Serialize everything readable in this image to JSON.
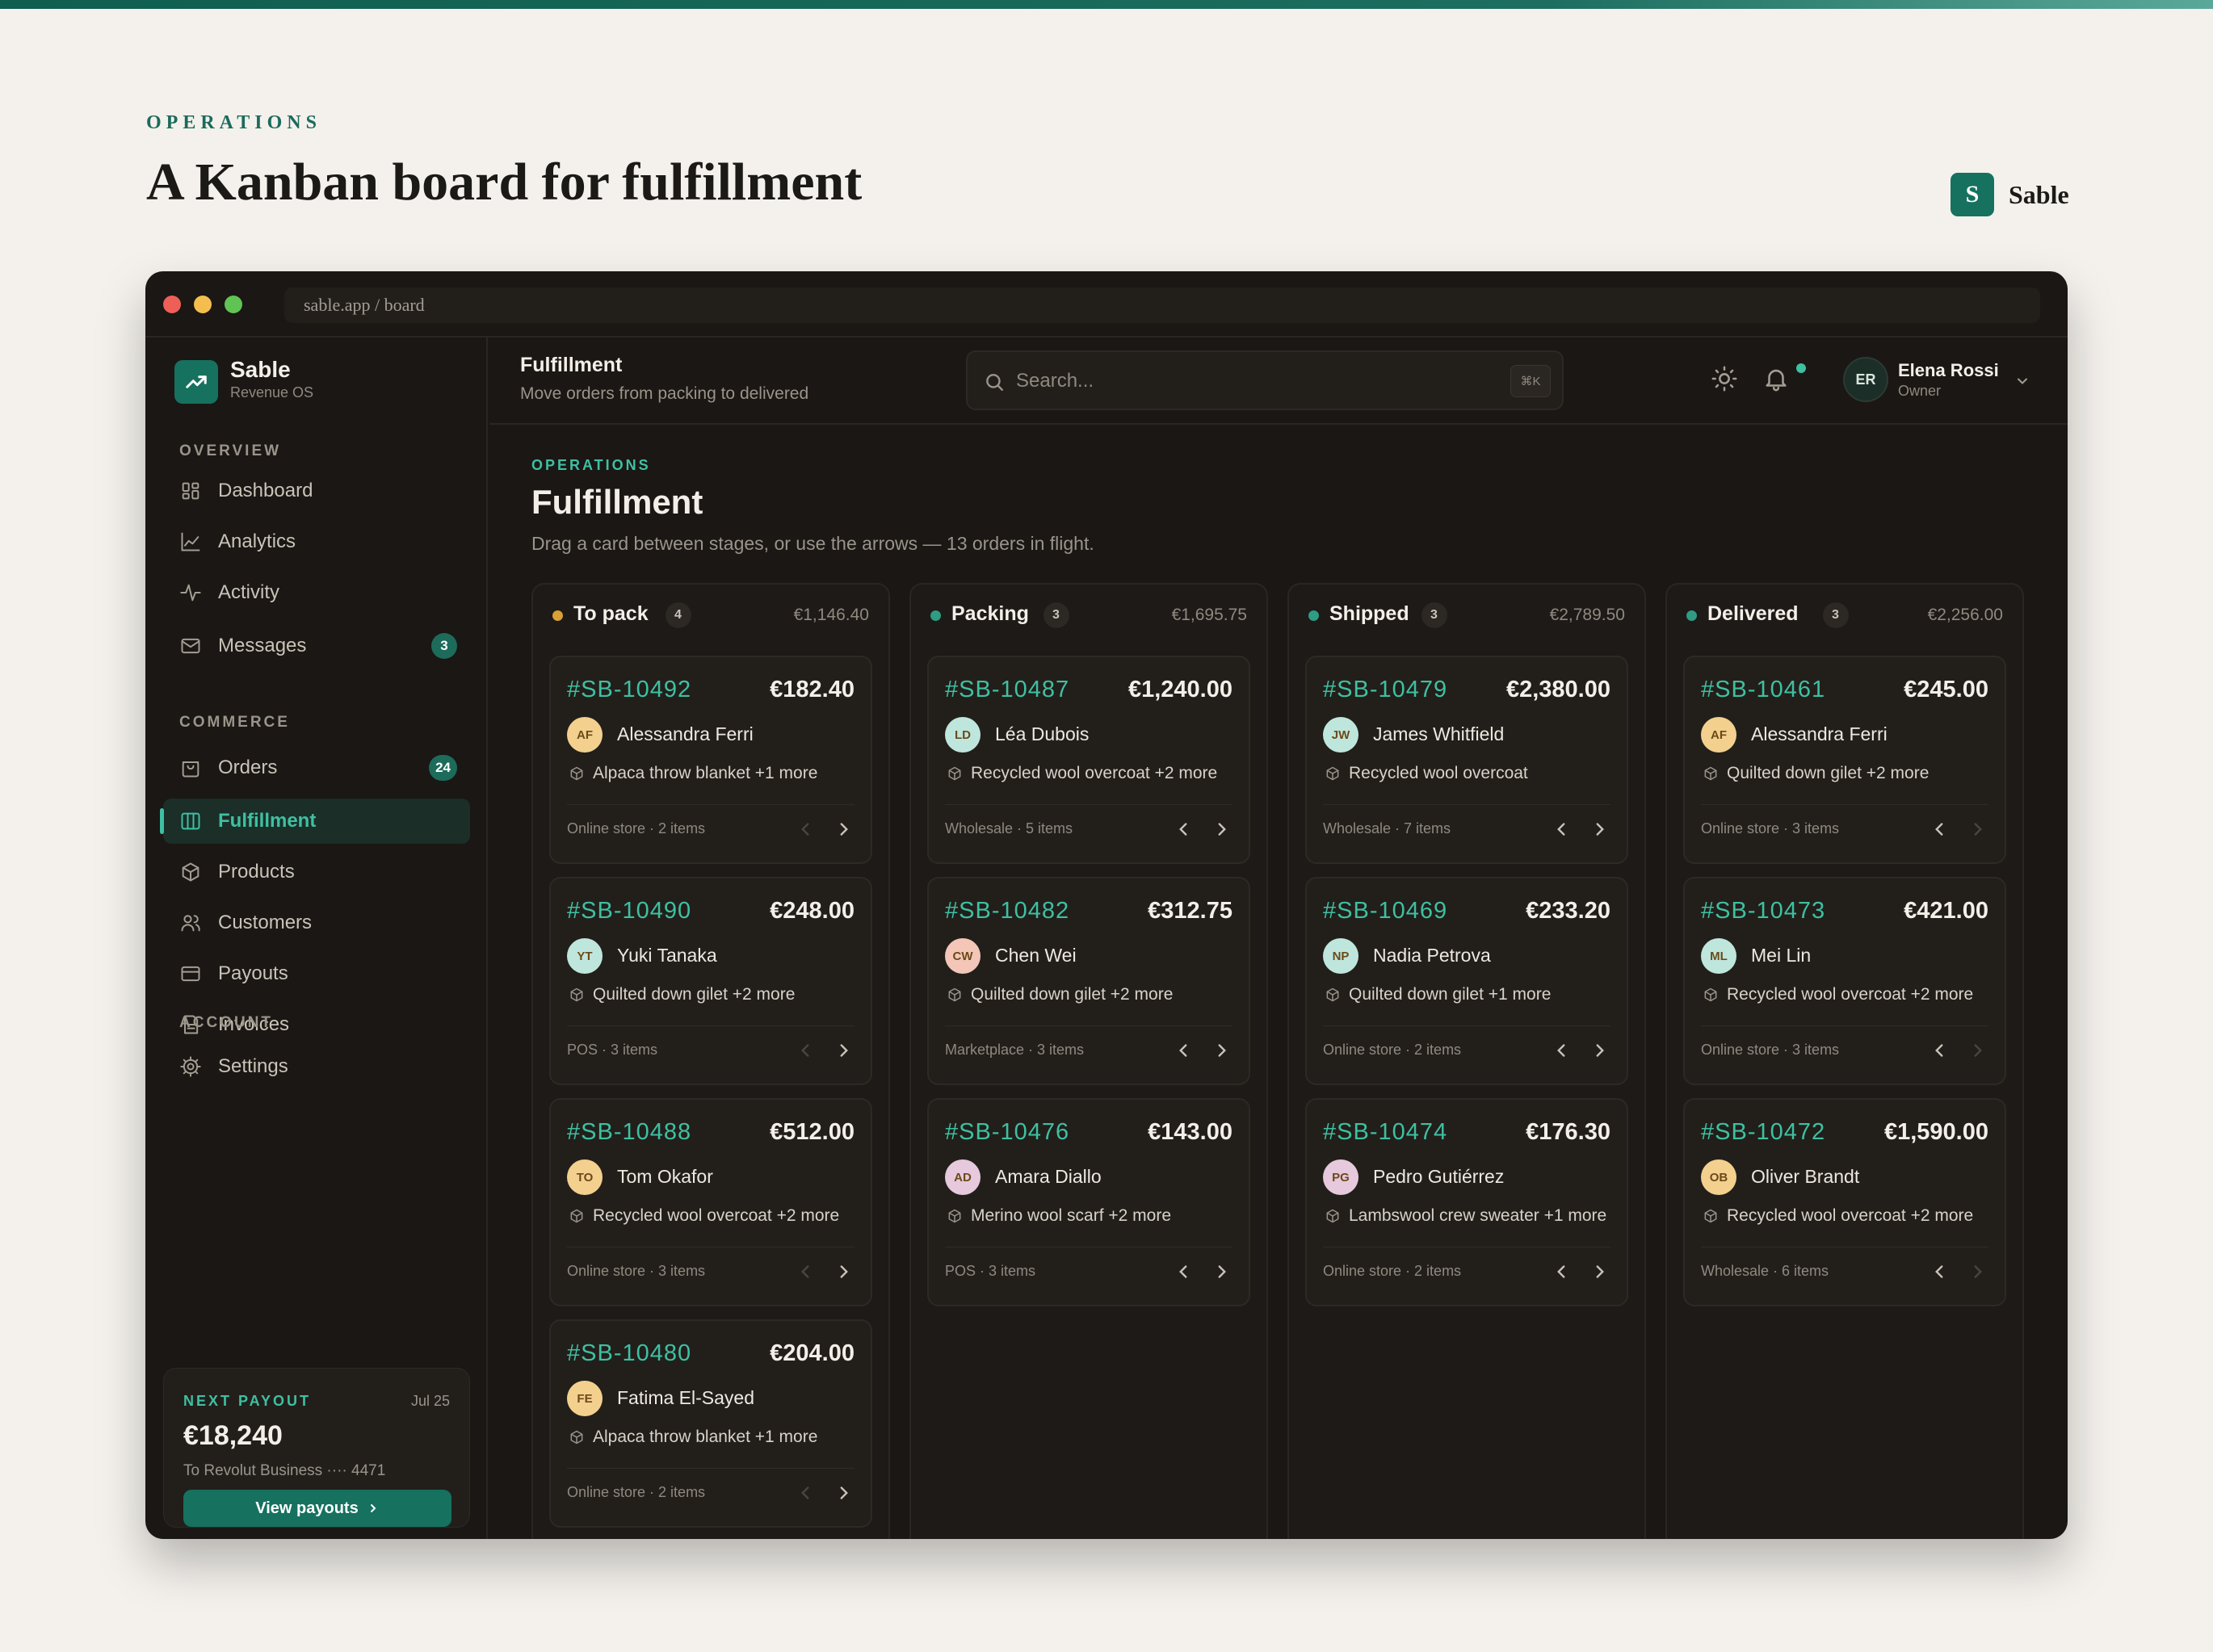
{
  "page": {
    "eyebrow": "OPERATIONS",
    "title": "A Kanban board for fulfillment",
    "brand_letter": "S",
    "brand_name": "Sable"
  },
  "browser": {
    "url": "sable.app / board"
  },
  "sidebar": {
    "app_name": "Sable",
    "app_sub": "Revenue OS",
    "sections": [
      {
        "label": "OVERVIEW",
        "items": [
          {
            "label": "Dashboard",
            "icon": "grid-icon"
          },
          {
            "label": "Analytics",
            "icon": "chart-line-icon"
          },
          {
            "label": "Activity",
            "icon": "pulse-icon"
          },
          {
            "label": "Messages",
            "icon": "mail-icon",
            "badge": "3"
          }
        ]
      },
      {
        "label": "COMMERCE",
        "items": [
          {
            "label": "Orders",
            "icon": "bag-icon",
            "badge": "24"
          },
          {
            "label": "Fulfillment",
            "icon": "board-icon",
            "active": true
          },
          {
            "label": "Products",
            "icon": "box-icon"
          },
          {
            "label": "Customers",
            "icon": "users-icon"
          },
          {
            "label": "Payouts",
            "icon": "card-icon"
          },
          {
            "label": "Invoices",
            "icon": "file-icon"
          }
        ]
      },
      {
        "label": "ACCOUNT",
        "items": [
          {
            "label": "Settings",
            "icon": "gear-icon"
          }
        ]
      }
    ],
    "payout": {
      "label": "NEXT PAYOUT",
      "date": "Jul 25",
      "amount": "€18,240",
      "destination": "To Revolut Business ···· 4471",
      "button": "View payouts"
    }
  },
  "header": {
    "title": "Fulfillment",
    "subtitle": "Move orders from packing to delivered",
    "search_placeholder": "Search...",
    "shortcut": "⌘K",
    "user_initials": "ER",
    "user_name": "Elena Rossi",
    "user_role": "Owner"
  },
  "content": {
    "eyebrow": "OPERATIONS",
    "title": "Fulfillment",
    "description": "Drag a card between stages, or use the arrows — 13 orders in flight."
  },
  "columns": [
    {
      "name": "To pack",
      "count": "4",
      "total": "€1,146.40",
      "color": "#d9a035",
      "cards": [
        {
          "id": "#SB-10492",
          "amount": "€182.40",
          "initials": "AF",
          "customer": "Alessandra Ferri",
          "items": "Alpaca throw blanket +1 more",
          "meta": "Online store · 2 items",
          "avatar_color": "#f3d08e"
        },
        {
          "id": "#SB-10490",
          "amount": "€248.00",
          "initials": "YT",
          "customer": "Yuki Tanaka",
          "items": "Quilted down gilet +2 more",
          "meta": "POS · 3 items",
          "avatar_color": "#bfe6dc"
        },
        {
          "id": "#SB-10488",
          "amount": "€512.00",
          "initials": "TO",
          "customer": "Tom Okafor",
          "items": "Recycled wool overcoat +2 more",
          "meta": "Online store · 3 items",
          "avatar_color": "#f3d08e"
        },
        {
          "id": "#SB-10480",
          "amount": "€204.00",
          "initials": "FE",
          "customer": "Fatima El-Sayed",
          "items": "Alpaca throw blanket +1 more",
          "meta": "Online store · 2 items",
          "avatar_color": "#f3d08e"
        }
      ]
    },
    {
      "name": "Packing",
      "count": "3",
      "total": "€1,695.75",
      "color": "#2f9c84",
      "cards": [
        {
          "id": "#SB-10487",
          "amount": "€1,240.00",
          "initials": "LD",
          "customer": "Léa Dubois",
          "items": "Recycled wool overcoat +2 more",
          "meta": "Wholesale · 5 items",
          "avatar_color": "#bfe6dc"
        },
        {
          "id": "#SB-10482",
          "amount": "€312.75",
          "initials": "CW",
          "customer": "Chen Wei",
          "items": "Quilted down gilet +2 more",
          "meta": "Marketplace · 3 items",
          "avatar_color": "#f4c6b8"
        },
        {
          "id": "#SB-10476",
          "amount": "€143.00",
          "initials": "AD",
          "customer": "Amara Diallo",
          "items": "Merino wool scarf +2 more",
          "meta": "POS · 3 items",
          "avatar_color": "#e6c9dc"
        }
      ]
    },
    {
      "name": "Shipped",
      "count": "3",
      "total": "€2,789.50",
      "color": "#2f9c84",
      "cards": [
        {
          "id": "#SB-10479",
          "amount": "€2,380.00",
          "initials": "JW",
          "customer": "James Whitfield",
          "items": "Recycled wool overcoat",
          "meta": "Wholesale · 7 items",
          "avatar_color": "#bfe6dc"
        },
        {
          "id": "#SB-10469",
          "amount": "€233.20",
          "initials": "NP",
          "customer": "Nadia Petrova",
          "items": "Quilted down gilet +1 more",
          "meta": "Online store · 2 items",
          "avatar_color": "#bfe6dc"
        },
        {
          "id": "#SB-10474",
          "amount": "€176.30",
          "initials": "PG",
          "customer": "Pedro Gutiérrez",
          "items": "Lambswool crew sweater +1 more",
          "meta": "Online store · 2 items",
          "avatar_color": "#e6c9dc"
        }
      ]
    },
    {
      "name": "Delivered",
      "count": "3",
      "total": "€2,256.00",
      "color": "#2f9c84",
      "cards": [
        {
          "id": "#SB-10461",
          "amount": "€245.00",
          "initials": "AF",
          "customer": "Alessandra Ferri",
          "items": "Quilted down gilet +2 more",
          "meta": "Online store · 3 items",
          "avatar_color": "#f3d08e"
        },
        {
          "id": "#SB-10473",
          "amount": "€421.00",
          "initials": "ML",
          "customer": "Mei Lin",
          "items": "Recycled wool overcoat +2 more",
          "meta": "Online store · 3 items",
          "avatar_color": "#bfe6dc"
        },
        {
          "id": "#SB-10472",
          "amount": "€1,590.00",
          "initials": "OB",
          "customer": "Oliver Brandt",
          "items": "Recycled wool overcoat +2 more",
          "meta": "Wholesale · 6 items",
          "avatar_color": "#f3d08e"
        }
      ]
    }
  ]
}
